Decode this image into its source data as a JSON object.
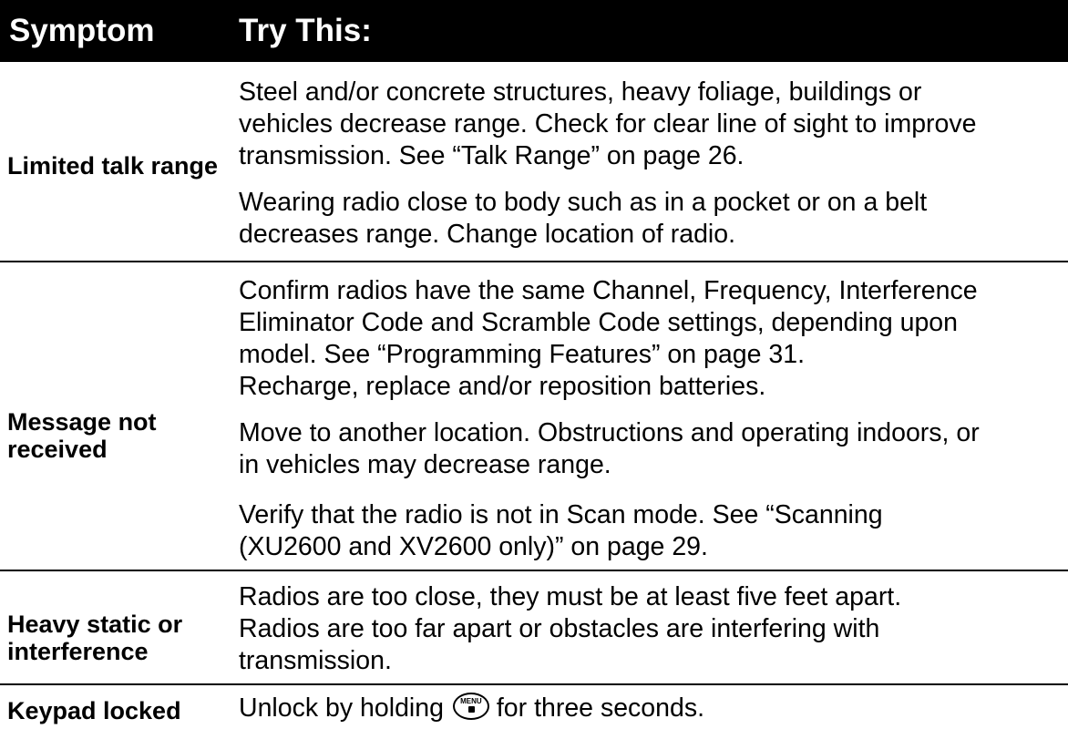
{
  "header": {
    "symptom": "Symptom",
    "try_this": "Try This:"
  },
  "rows": [
    {
      "symptom": "Limited talk range",
      "paragraphs": [
        [
          "Steel and/or concrete structures, heavy foliage, buildings or",
          "vehicles decrease range. Check for clear line of sight to improve",
          "transmission. See “Talk Range” on page 26."
        ],
        [
          "Wearing radio close to body such as in a pocket or on a belt",
          "decreases range. Change location of radio."
        ]
      ]
    },
    {
      "symptom": "Message not received",
      "paragraphs": [
        [
          "Confirm radios have the same Channel, Frequency, Interference",
          "Eliminator Code and Scramble Code settings, depending upon",
          "model. See “Programming Features” on page 31.",
          "Recharge, replace and/or reposition batteries."
        ],
        [
          "Move to another location. Obstructions and operating indoors, or",
          "in vehicles may decrease range."
        ],
        [
          "Verify that the radio is not in Scan mode. See “Scanning",
          "(XU2600 and XV2600 only)” on page 29."
        ]
      ]
    },
    {
      "symptom": "Heavy static or interference",
      "paragraphs": [
        [
          "Radios are too close, they must be at least five feet apart.",
          "Radios are too far apart or obstacles are interfering with",
          "transmission."
        ]
      ]
    },
    {
      "symptom": "Keypad locked",
      "paragraphs": [
        {
          "before_icon": "Unlock by holding",
          "icon": "menu-lock-icon",
          "icon_label": "MENU",
          "after_icon": "for three seconds."
        }
      ]
    }
  ]
}
